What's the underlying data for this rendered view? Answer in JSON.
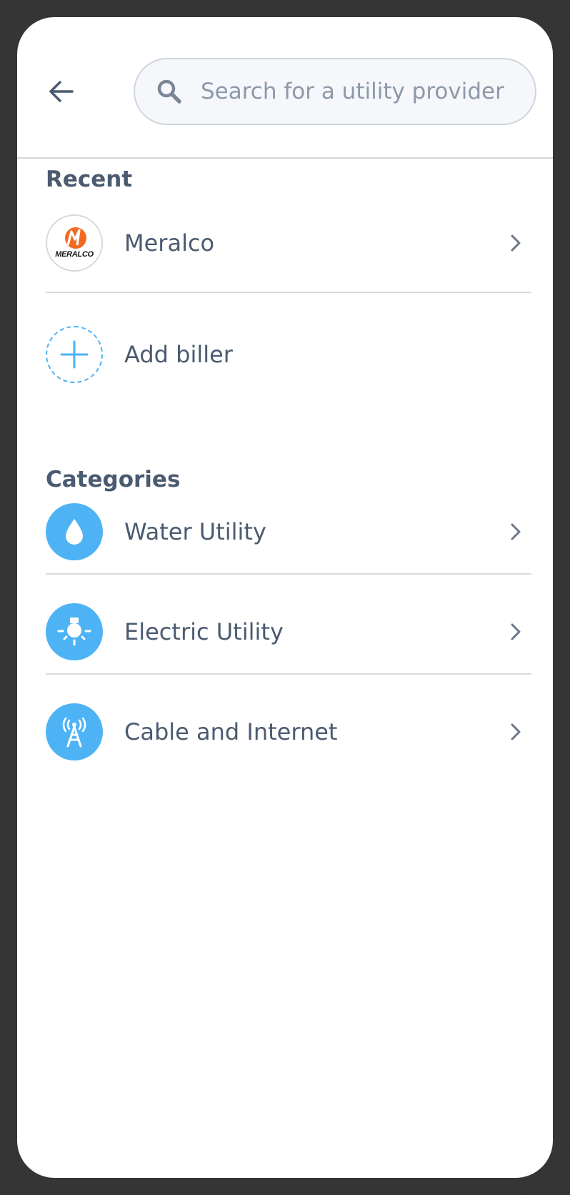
{
  "search": {
    "placeholder": "Search for a utility provider"
  },
  "recent": {
    "title": "Recent",
    "items": [
      {
        "label": "Meralco",
        "logo_text": "MERALCO"
      }
    ],
    "add_label": "Add biller"
  },
  "categories": {
    "title": "Categories",
    "items": [
      {
        "label": "Water Utility",
        "icon": "water-drop-icon"
      },
      {
        "label": "Electric Utility",
        "icon": "light-bulb-icon"
      },
      {
        "label": "Cable and Internet",
        "icon": "antenna-tower-icon"
      }
    ]
  },
  "colors": {
    "accent": "#4DB3F5",
    "text": "#4A5A70",
    "meralco_orange": "#F26A21"
  }
}
